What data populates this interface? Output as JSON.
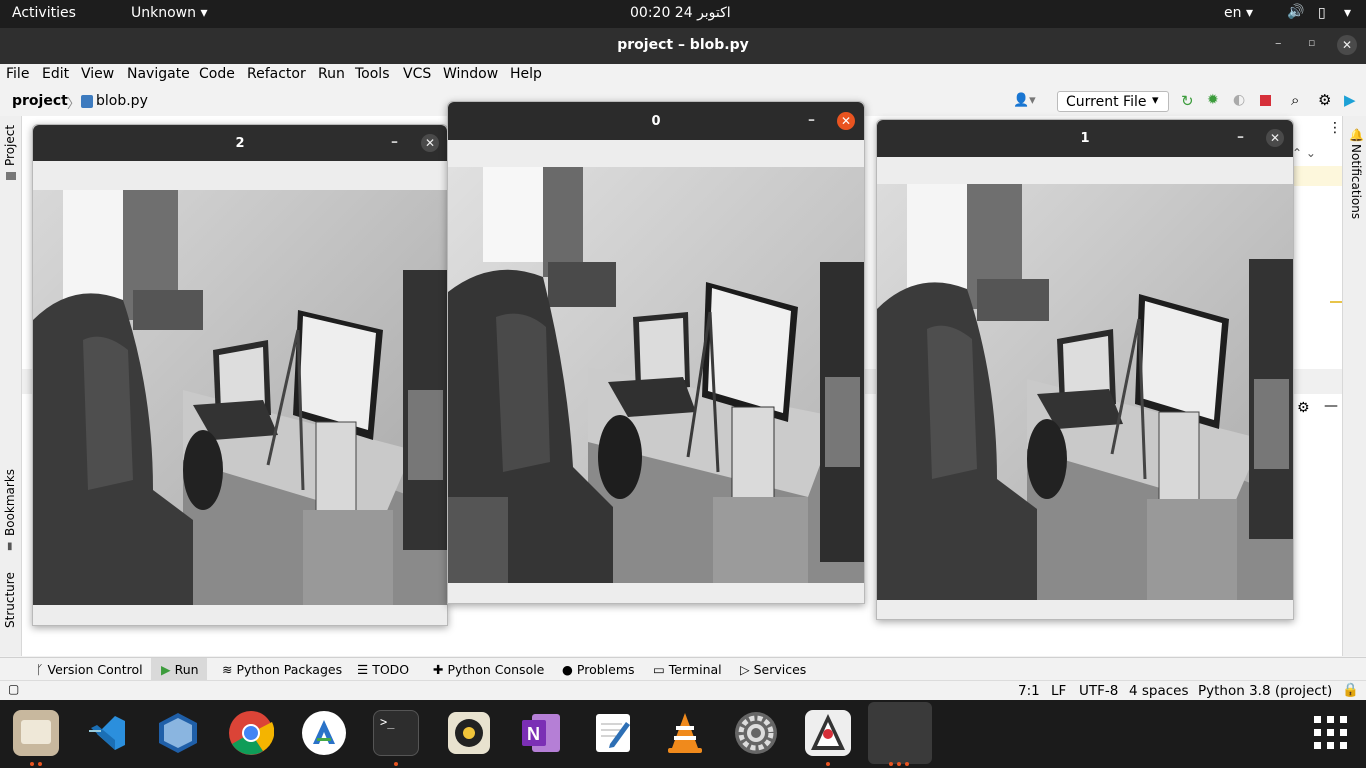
{
  "topbar": {
    "activities": "Activities",
    "app_menu": "Unknown",
    "clock": "00:20  24 اکتوبر",
    "lang": "en"
  },
  "titlebar": {
    "title": "project – blob.py"
  },
  "menu": [
    "File",
    "Edit",
    "View",
    "Navigate",
    "Code",
    "Refactor",
    "Run",
    "Tools",
    "VCS",
    "Window",
    "Help"
  ],
  "nav": {
    "project": "project",
    "file": "blob.py",
    "run_config": "Current File"
  },
  "left_tabs": {
    "project": "Project",
    "bookmarks": "Bookmarks",
    "structure": "Structure"
  },
  "right_tabs": {
    "notifications": "Notifications"
  },
  "windows": [
    {
      "title": "2"
    },
    {
      "title": "0"
    },
    {
      "title": "1"
    }
  ],
  "toolwindows": [
    "Version Control",
    "Run",
    "Python Packages",
    "TODO",
    "Python Console",
    "Problems",
    "Terminal",
    "Services"
  ],
  "status": {
    "position": "7:1",
    "line_sep": "LF",
    "encoding": "UTF-8",
    "indent": "4 spaces",
    "interpreter": "Python 3.8 (project)"
  },
  "dock": [
    "files-icon",
    "vscode-icon",
    "virtualbox-icon",
    "chrome-icon",
    "anaconda-icon",
    "terminal-icon",
    "rhythmbox-icon",
    "onenote-icon",
    "text-editor-icon",
    "vlc-icon",
    "settings-icon",
    "java-icon",
    "active-window-icon",
    "show-apps-icon"
  ],
  "colors": {
    "accent": "#e95420",
    "topbar": "#1d1d1d",
    "dock": "#1b1b1b"
  }
}
